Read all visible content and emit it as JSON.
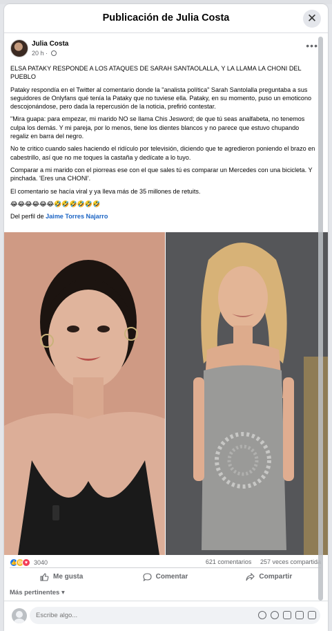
{
  "modal": {
    "title": "Publicación de Julia Costa",
    "close_icon": "close-icon"
  },
  "post": {
    "author": "Julia Costa",
    "time": "20 h ·",
    "visibility_icon": "globe-icon",
    "more_icon": "more-options-icon",
    "paragraphs": [
      "ELSA PATAKY RESPONDE A LOS ATAQUES DE SARAH SANTAOLALLA, Y LA LLAMA LA CHONI DEL PUEBLO",
      "Pataky respondía en el Twitter al comentario donde la \"analista política\" Sarah Santolalla preguntaba a sus seguidores de Onlyfans qué tenía la Pataky que no tuviese ella. Pataky, en su momento, puso un emoticono descojonándose, pero dada la repercusión de la noticia, prefirió contestar.",
      "\"Mira guapa: para empezar, mi marido NO se llama Chis Jesword; de que tú seas analfabeta, no tenemos culpa los demás. Y mi pareja, por lo menos, tiene los dientes blancos y no parece que estuvo chupando regaliz en barra del negro.",
      "No te critico cuando sales haciendo el ridículo por televisión, diciendo que te agredieron poniendo el brazo en cabestrillo, así que no me toques la castaña y dedícate a lo tuyo.",
      "Comparar a mi marido con el piorreas ese con el que sales tú es comparar un Mercedes con una bicicleta. Y pinchada. 'Eres una CHONI'.",
      "El comentario se hacía viral y ya lleva más de 35 millones de retuits."
    ],
    "emojis": "😂😂😂😂😂😂🤣🤣🤣🤣🤣🤣",
    "credit_prefix": "Del perfil de ",
    "credit_link": "Jaime Torres Najarro"
  },
  "stats": {
    "reaction_count": "3040",
    "comments": "621 comentarios",
    "shares": "257 veces compartida"
  },
  "actions": {
    "like": "Me gusta",
    "comment": "Comentar",
    "share": "Compartir"
  },
  "relevant": "Más pertinentes ▾",
  "composer": {
    "placeholder": "Escribe algo..."
  },
  "colors": {
    "link": "#1b64c4",
    "like_blue": "#1877f2",
    "muted": "#65676b"
  }
}
